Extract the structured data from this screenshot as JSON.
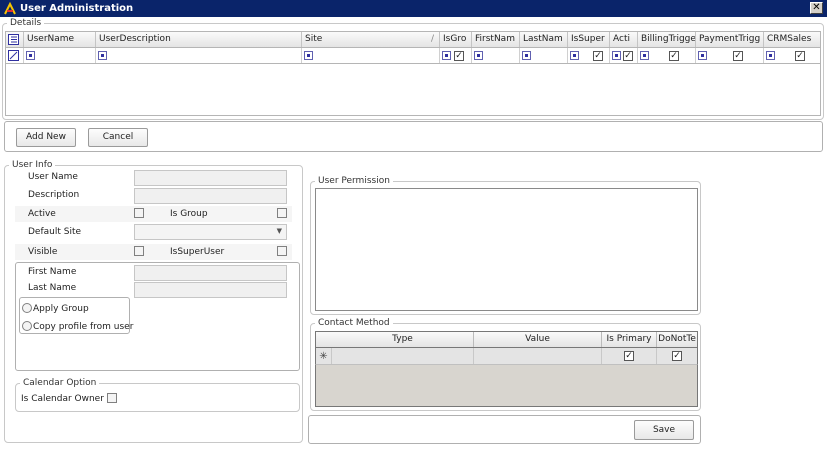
{
  "window": {
    "title": "User Administration",
    "close_glyph": "✕"
  },
  "details": {
    "legend": "Details",
    "columns": [
      "UserName",
      "UserDescription",
      "Site",
      "IsGro",
      "FirstNam",
      "LastNam",
      "IsSuper",
      "Acti",
      "BillingTrigge",
      "PaymentTrigg",
      "CRMSales"
    ],
    "sort_glyph": "/"
  },
  "actions": {
    "add_new": "Add New",
    "cancel": "Cancel"
  },
  "user_info": {
    "legend": "User Info",
    "user_name_label": "User Name",
    "description_label": "Description",
    "active_label": "Active",
    "is_group_label": "Is Group",
    "default_site_label": "Default Site",
    "visible_label": "Visible",
    "is_super_user_label": "IsSuperUser",
    "first_name_label": "First Name",
    "last_name_label": "Last Name",
    "apply_group_label": "Apply Group",
    "copy_profile_label": "Copy profile from user"
  },
  "calendar": {
    "legend": "Calendar Option",
    "is_calendar_owner_label": "Is Calendar Owner"
  },
  "permission": {
    "legend": "User Permission"
  },
  "contact": {
    "legend": "Contact Method",
    "columns": [
      "Type",
      "Value",
      "Is Primary",
      "DoNotTe"
    ],
    "new_row_glyph": "✳"
  },
  "save_label": "Save",
  "colors": {
    "titlebar": "#0a246a",
    "accent": "#3030a0"
  }
}
